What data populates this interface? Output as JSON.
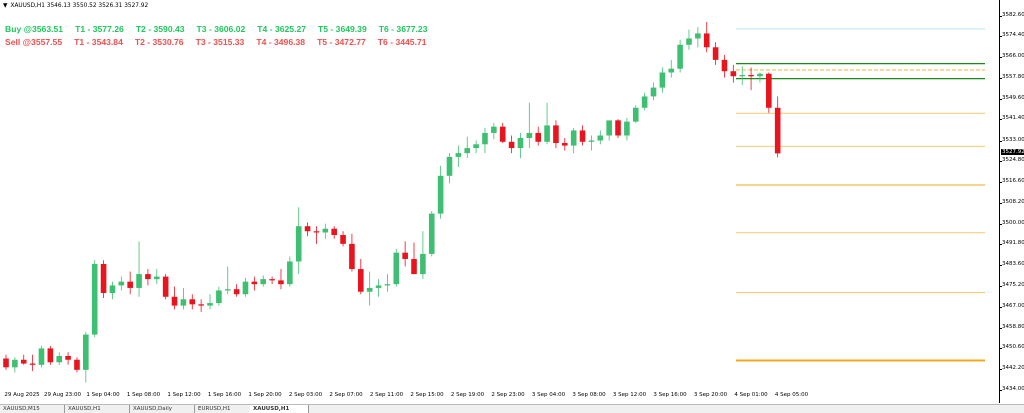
{
  "header": {
    "symbol_line": "XAUUSD,H1  3546.13 3550.52 3526.31 3527.92"
  },
  "signals": {
    "buy": {
      "entry": "Buy @3563.51",
      "targets": [
        "T1 - 3577.26",
        "T2 - 3590.43",
        "T3 - 3606.02",
        "T4 - 3625.27",
        "T5 - 3649.39",
        "T6 - 3677.23"
      ],
      "color": "#22c55e"
    },
    "sell": {
      "entry": "Sell @3557.55",
      "targets": [
        "T1 - 3543.84",
        "T2 - 3530.76",
        "T3 - 3515.33",
        "T4 - 3496.38",
        "T5 - 3472.77",
        "T6 - 3445.71"
      ],
      "color": "#f05050"
    }
  },
  "colors": {
    "bull": "#3fbf72",
    "bear": "#e8141e",
    "green_level": "#1a8a1a",
    "orange_level": "#f0a818",
    "blue_level": "#8fd0ea"
  },
  "chart_data": {
    "type": "candlestick",
    "ylim": [
      3434.0,
      3584.0
    ],
    "y_ticks": [
      "3582.60",
      "3574.40",
      "3566.00",
      "3557.80",
      "3549.60",
      "3541.40",
      "3533.00",
      "3524.80",
      "3516.60",
      "3508.20",
      "3500.00",
      "3491.80",
      "3483.60",
      "3475.20",
      "3467.00",
      "3458.80",
      "3450.60",
      "3442.20",
      "3434.00"
    ],
    "last_price_label": "3527.92",
    "x_ticks": [
      "29 Aug 2025",
      "29 Aug 23:00",
      "1 Sep 04:00",
      "1 Sep 08:00",
      "1 Sep 12:00",
      "1 Sep 16:00",
      "1 Sep 20:00",
      "2 Sep 03:00",
      "2 Sep 07:00",
      "2 Sep 11:00",
      "2 Sep 15:00",
      "2 Sep 19:00",
      "2 Sep 23:00",
      "3 Sep 04:00",
      "3 Sep 08:00",
      "3 Sep 12:00",
      "3 Sep 16:00",
      "3 Sep 20:00",
      "4 Sep 01:00",
      "4 Sep 05:00"
    ],
    "candles": [
      [
        3446.5,
        3448.0,
        3442.0,
        3443.0
      ],
      [
        3443.0,
        3447.0,
        3441.0,
        3446.0
      ],
      [
        3446.0,
        3448.0,
        3444.0,
        3444.5
      ],
      [
        3444.5,
        3448.0,
        3441.5,
        3444.0
      ],
      [
        3444.0,
        3451.5,
        3443.0,
        3450.5
      ],
      [
        3450.5,
        3451.5,
        3444.0,
        3445.0
      ],
      [
        3445.0,
        3449.0,
        3444.0,
        3447.5
      ],
      [
        3447.5,
        3449.0,
        3444.0,
        3446.0
      ],
      [
        3446.0,
        3447.0,
        3441.0,
        3442.0
      ],
      [
        3442.0,
        3457.0,
        3437.0,
        3456.0
      ],
      [
        3456.0,
        3485.5,
        3455.0,
        3484.0
      ],
      [
        3484.0,
        3485.5,
        3470.5,
        3472.5
      ],
      [
        3472.5,
        3477.0,
        3470.0,
        3475.5
      ],
      [
        3475.5,
        3479.0,
        3473.5,
        3477.0
      ],
      [
        3477.0,
        3481.0,
        3472.0,
        3474.5
      ],
      [
        3474.5,
        3493.0,
        3471.0,
        3480.0
      ],
      [
        3480.0,
        3482.0,
        3475.5,
        3478.0
      ],
      [
        3478.0,
        3482.0,
        3476.0,
        3479.0
      ],
      [
        3479.0,
        3480.0,
        3470.0,
        3471.0
      ],
      [
        3471.0,
        3475.0,
        3466.0,
        3467.5
      ],
      [
        3467.5,
        3474.5,
        3466.0,
        3470.0
      ],
      [
        3470.0,
        3472.0,
        3466.0,
        3468.0
      ],
      [
        3468.0,
        3470.0,
        3465.0,
        3467.5
      ],
      [
        3467.5,
        3472.0,
        3466.0,
        3468.5
      ],
      [
        3468.5,
        3475.0,
        3467.5,
        3473.5
      ],
      [
        3473.5,
        3483.0,
        3472.0,
        3474.0
      ],
      [
        3474.0,
        3476.0,
        3471.0,
        3472.0
      ],
      [
        3472.0,
        3478.5,
        3471.0,
        3477.0
      ],
      [
        3477.0,
        3479.0,
        3473.5,
        3476.0
      ],
      [
        3476.0,
        3479.5,
        3475.0,
        3478.0
      ],
      [
        3478.0,
        3479.0,
        3476.0,
        3477.5
      ],
      [
        3477.5,
        3482.0,
        3474.0,
        3476.0
      ],
      [
        3476.0,
        3487.0,
        3475.0,
        3485.0
      ],
      [
        3485.0,
        3506.5,
        3480.0,
        3499.0
      ],
      [
        3499.0,
        3500.5,
        3495.0,
        3497.0
      ],
      [
        3497.0,
        3499.0,
        3492.0,
        3496.5
      ],
      [
        3496.5,
        3500.0,
        3494.0,
        3498.0
      ],
      [
        3498.0,
        3499.0,
        3494.0,
        3495.5
      ],
      [
        3495.5,
        3497.0,
        3491.0,
        3492.0
      ],
      [
        3492.0,
        3496.0,
        3481.0,
        3482.0
      ],
      [
        3482.0,
        3486.0,
        3472.0,
        3473.0
      ],
      [
        3473.0,
        3481.0,
        3467.5,
        3474.5
      ],
      [
        3474.5,
        3478.0,
        3471.0,
        3475.5
      ],
      [
        3475.5,
        3480.0,
        3473.0,
        3476.0
      ],
      [
        3476.0,
        3490.0,
        3475.0,
        3488.5
      ],
      [
        3488.5,
        3493.0,
        3483.0,
        3486.0
      ],
      [
        3486.0,
        3492.5,
        3484.0,
        3480.0
      ],
      [
        3480.0,
        3497.0,
        3478.0,
        3488.0
      ],
      [
        3488.0,
        3505.0,
        3487.0,
        3504.0
      ],
      [
        3504.0,
        3523.0,
        3502.0,
        3519.0
      ],
      [
        3519.0,
        3528.0,
        3516.0,
        3526.5
      ],
      [
        3526.5,
        3531.0,
        3522.5,
        3528.0
      ],
      [
        3528.0,
        3534.5,
        3526.0,
        3530.0
      ],
      [
        3530.0,
        3533.0,
        3528.0,
        3531.5
      ],
      [
        3531.5,
        3538.0,
        3528.0,
        3536.0
      ],
      [
        3536.0,
        3540.0,
        3533.5,
        3538.5
      ],
      [
        3538.5,
        3540.0,
        3532.0,
        3532.5
      ],
      [
        3532.5,
        3535.0,
        3528.0,
        3530.0
      ],
      [
        3530.0,
        3536.0,
        3526.0,
        3534.0
      ],
      [
        3534.0,
        3548.0,
        3530.0,
        3536.0
      ],
      [
        3536.0,
        3538.5,
        3531.0,
        3532.5
      ],
      [
        3532.5,
        3548.0,
        3531.5,
        3539.0
      ],
      [
        3539.0,
        3541.0,
        3530.0,
        3532.0
      ],
      [
        3532.0,
        3534.0,
        3529.0,
        3531.0
      ],
      [
        3531.0,
        3538.0,
        3528.0,
        3537.0
      ],
      [
        3537.0,
        3539.0,
        3531.0,
        3532.5
      ],
      [
        3532.5,
        3535.0,
        3529.0,
        3533.0
      ],
      [
        3533.0,
        3537.0,
        3531.5,
        3535.0
      ],
      [
        3535.0,
        3539.5,
        3533.0,
        3541.0
      ],
      [
        3541.0,
        3541.5,
        3534.0,
        3535.0
      ],
      [
        3535.0,
        3542.0,
        3533.0,
        3540.5
      ],
      [
        3540.5,
        3547.0,
        3540.0,
        3546.0
      ],
      [
        3546.0,
        3552.0,
        3545.0,
        3550.5
      ],
      [
        3550.5,
        3556.0,
        3549.0,
        3554.0
      ],
      [
        3554.0,
        3562.0,
        3552.0,
        3560.0
      ],
      [
        3560.0,
        3565.0,
        3558.0,
        3561.5
      ],
      [
        3561.5,
        3573.0,
        3560.0,
        3571.0
      ],
      [
        3571.0,
        3577.0,
        3569.0,
        3573.5
      ],
      [
        3573.5,
        3578.0,
        3570.0,
        3575.5
      ],
      [
        3575.5,
        3580.0,
        3568.0,
        3570.0
      ],
      [
        3570.0,
        3572.0,
        3563.0,
        3565.0
      ],
      [
        3565.0,
        3567.0,
        3558.0,
        3560.5
      ],
      [
        3560.5,
        3563.0,
        3556.0,
        3558.5
      ],
      [
        3558.5,
        3562.5,
        3555.0,
        3559.0
      ],
      [
        3559.0,
        3562.0,
        3553.0,
        3558.5
      ],
      [
        3558.5,
        3560.0,
        3556.0,
        3559.5
      ],
      [
        3559.5,
        3560.0,
        3544.0,
        3546.0
      ],
      [
        3546.0,
        3550.5,
        3526.3,
        3527.9
      ]
    ],
    "levels": [
      {
        "value": 3577.26,
        "color": "blue_level",
        "width": 0.6
      },
      {
        "value": 3563.51,
        "color": "green_level",
        "width": 1.2
      },
      {
        "value": 3561.0,
        "color": "orange_level",
        "width": 0.8,
        "dash": true
      },
      {
        "value": 3557.55,
        "color": "green_level",
        "width": 1.2
      },
      {
        "value": 3543.84,
        "color": "orange_level",
        "width": 0.7
      },
      {
        "value": 3530.76,
        "color": "orange_level",
        "width": 0.7
      },
      {
        "value": 3515.33,
        "color": "orange_level",
        "width": 1.0
      },
      {
        "value": 3496.38,
        "color": "orange_level",
        "width": 0.7
      },
      {
        "value": 3472.77,
        "color": "orange_level",
        "width": 0.7
      },
      {
        "value": 3445.71,
        "color": "orange_level",
        "width": 2.0
      }
    ]
  },
  "tabs": [
    "XAUUSD,M15",
    "XAUUSD,H1",
    "XAUUSD,Daily",
    "EURUSD,H1",
    "XAUUSD,H1"
  ]
}
